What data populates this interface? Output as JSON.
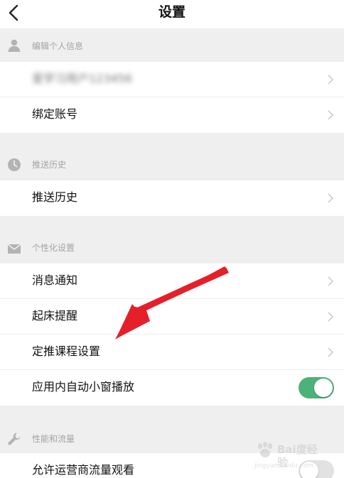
{
  "nav": {
    "title": "设置"
  },
  "sections": {
    "profile": {
      "label": "编辑个人信息"
    },
    "push": {
      "label": "推送历史"
    },
    "personal": {
      "label": "个性化设置"
    },
    "performance": {
      "label": "性能和流量"
    }
  },
  "rows": {
    "account_name": "爱学习用户123456",
    "bind_account": "绑定账号",
    "push_history": "推送历史",
    "notifications": "消息通知",
    "wake_reminder": "起床提醒",
    "course_push": "定推课程设置",
    "autoplay_small_window": "应用内自动小窗播放",
    "carrier_data": "允许运营商流量观看"
  },
  "toggles": {
    "autoplay_small_window": true,
    "carrier_data": false
  },
  "colors": {
    "toggle_on": "#4cb17a",
    "annotation_arrow": "#e5202a",
    "section_bg": "#efefef"
  },
  "watermark": {
    "text": "Bai度经验",
    "url": "jingyan.baidu.com"
  }
}
